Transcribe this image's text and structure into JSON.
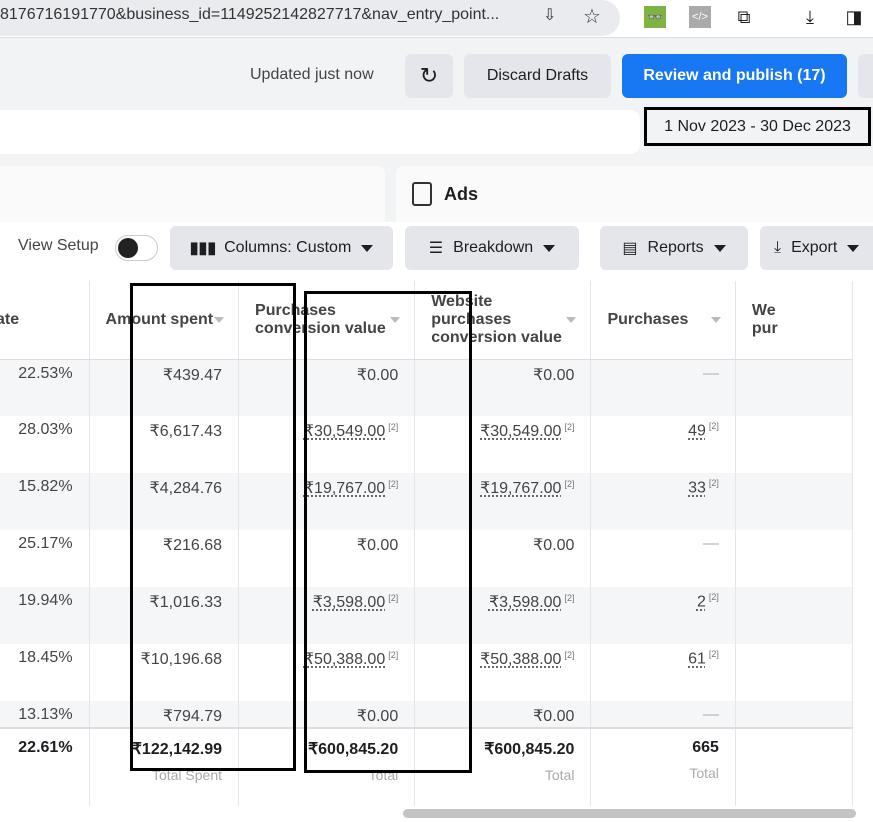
{
  "browser": {
    "url": "8176716191770&business_id=1149252142827717&nav_entry_point..."
  },
  "header": {
    "status": "Updated just now",
    "discard_label": "Discard Drafts",
    "publish_label": "Review and publish (17)"
  },
  "date_range": "1 Nov 2023 - 30 Dec 2023",
  "panel": {
    "ads_label": "Ads"
  },
  "toolbar": {
    "view_setup": "View Setup",
    "columns": "Columns: Custom",
    "breakdown": "Breakdown",
    "reports": "Reports",
    "export": "Export"
  },
  "table": {
    "headers": [
      "ate",
      "Amount spent",
      "Purchases conversion value",
      "Website purchases conversion value",
      "Purchases",
      "We pur"
    ],
    "rows": [
      [
        "22.53%",
        "₹439.47",
        "₹0.00",
        "₹0.00",
        "—"
      ],
      [
        "28.03%",
        "₹6,617.43",
        "₹30,549.00",
        "₹30,549.00",
        "49"
      ],
      [
        "15.82%",
        "₹4,284.76",
        "₹19,767.00",
        "₹19,767.00",
        "33"
      ],
      [
        "25.17%",
        "₹216.68",
        "₹0.00",
        "₹0.00",
        "—"
      ],
      [
        "19.94%",
        "₹1,016.33",
        "₹3,598.00",
        "₹3,598.00",
        "2"
      ],
      [
        "18.45%",
        "₹10,196.68",
        "₹50,388.00",
        "₹50,388.00",
        "61"
      ],
      [
        "13.13%",
        "₹794.79",
        "₹0.00",
        "₹0.00",
        "—"
      ]
    ],
    "footnote": "[2]",
    "totals": [
      "22.61%",
      "₹122,142.99",
      "₹600,845.20",
      "₹600,845.20",
      "665"
    ],
    "total_labels": [
      "",
      "Total Spent",
      "Total",
      "Total",
      "Total"
    ]
  },
  "colors": {
    "accent": "#1877f2"
  }
}
